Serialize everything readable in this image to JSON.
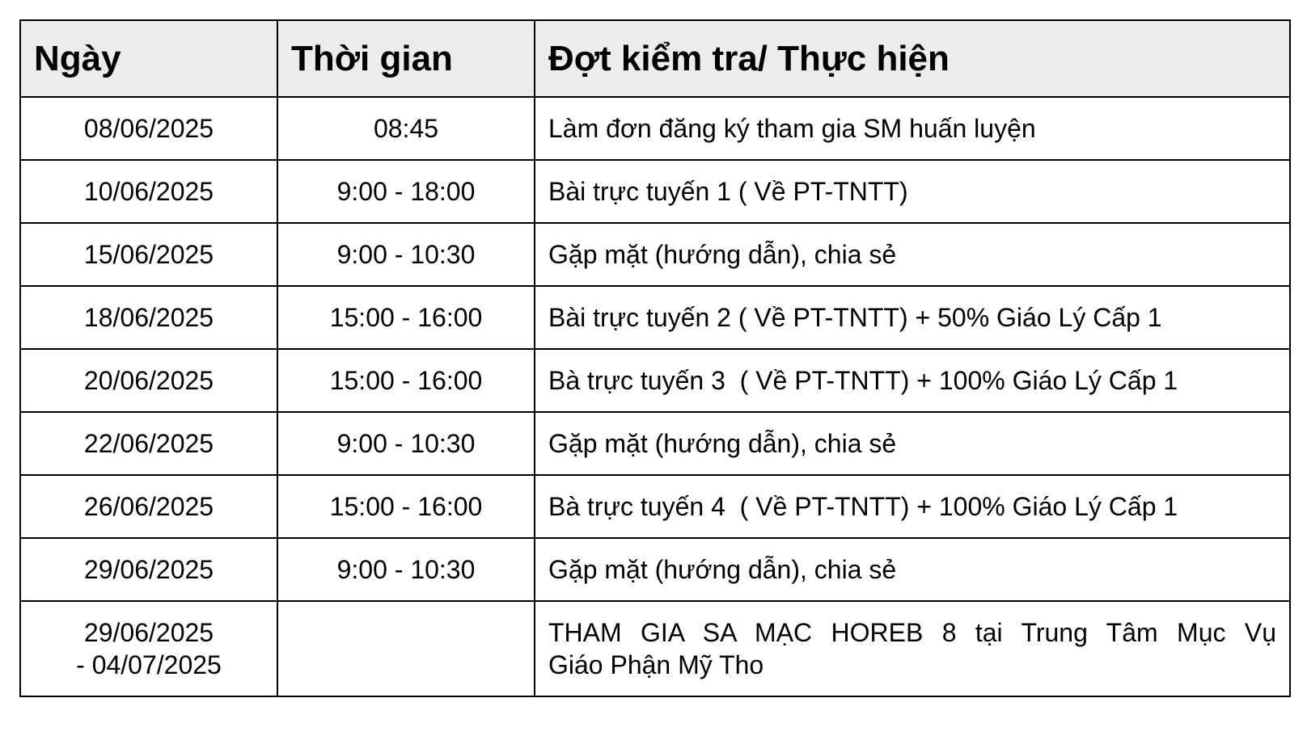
{
  "table": {
    "headers": [
      "Ngày",
      "Thời gian",
      "Đợt kiểm tra/ Thực hiện"
    ],
    "rows": [
      {
        "date": "08/06/2025",
        "time": "08:45",
        "task": "Làm đơn đăng ký tham gia SM huấn luyện"
      },
      {
        "date": "10/06/2025",
        "time": "9:00 - 18:00",
        "task": "Bài trực tuyến 1 ( Về PT-TNTT)"
      },
      {
        "date": "15/06/2025",
        "time": "9:00 - 10:30",
        "task": "Gặp mặt (hướng dẫn), chia sẻ"
      },
      {
        "date": "18/06/2025",
        "time": "15:00 - 16:00",
        "task": "Bài trực tuyến 2 ( Về PT-TNTT) + 50% Giáo Lý Cấp 1"
      },
      {
        "date": "20/06/2025",
        "time": "15:00 - 16:00",
        "task": "Bà trực tuyến 3  ( Về PT-TNTT) + 100% Giáo Lý Cấp 1"
      },
      {
        "date": "22/06/2025",
        "time": "9:00 - 10:30",
        "task": "Gặp mặt (hướng dẫn), chia sẻ"
      },
      {
        "date": "26/06/2025",
        "time": "15:00 - 16:00",
        "task": "Bà trực tuyến 4  ( Về PT-TNTT) + 100% Giáo Lý Cấp 1"
      },
      {
        "date": "29/06/2025",
        "time": "9:00 - 10:30",
        "task": "Gặp mặt (hướng dẫn), chia sẻ"
      },
      {
        "date_line1": "29/06/2025",
        "date_line2": "- 04/07/2025",
        "time": "",
        "task_line1": "THAM GIA SA MẠC HOREB 8 tại Trung Tâm Mục Vụ",
        "task_line2": "Giáo Phận Mỹ Tho"
      }
    ]
  }
}
